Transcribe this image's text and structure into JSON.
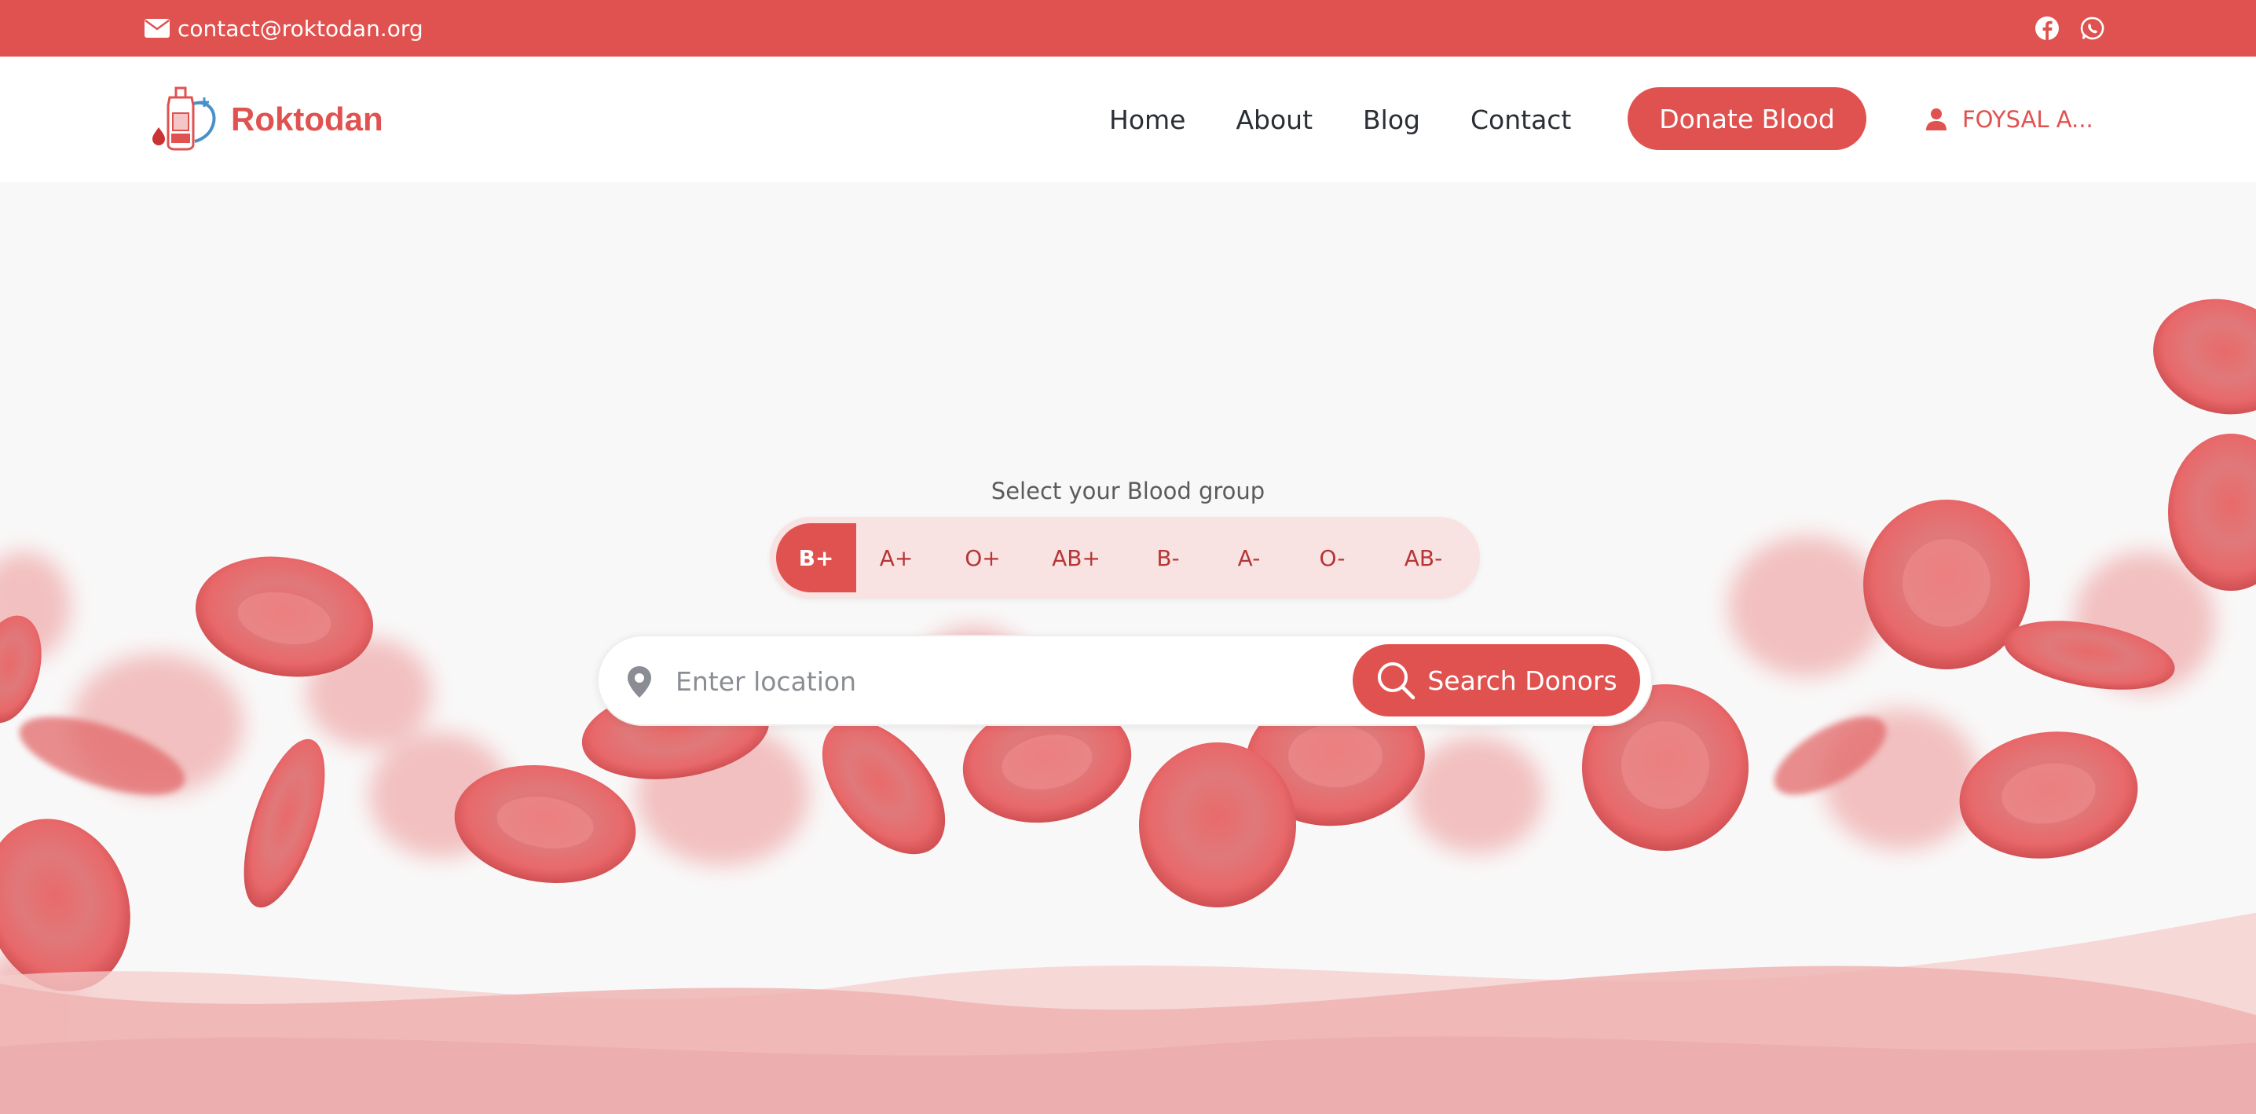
{
  "topbar": {
    "email": "contact@roktodan.org",
    "icons": [
      "envelope-icon",
      "facebook-icon",
      "whatsapp-icon"
    ]
  },
  "header": {
    "brand": "Roktodan",
    "nav": [
      "Home",
      "About",
      "Blog",
      "Contact"
    ],
    "donate_label": "Donate Blood",
    "user_name": "FOYSAL A..."
  },
  "hero": {
    "blood_group_label": "Select your Blood group",
    "blood_groups": [
      "B+",
      "A+",
      "O+",
      "AB+",
      "B-",
      "A-",
      "O-",
      "AB-"
    ],
    "selected_group": "B+",
    "search": {
      "placeholder": "Enter location",
      "value": "",
      "button_label": "Search Donors"
    }
  },
  "colors": {
    "accent": "#e0524f",
    "chip_bg": "#f8e2e2",
    "chip_text": "#b63535"
  }
}
